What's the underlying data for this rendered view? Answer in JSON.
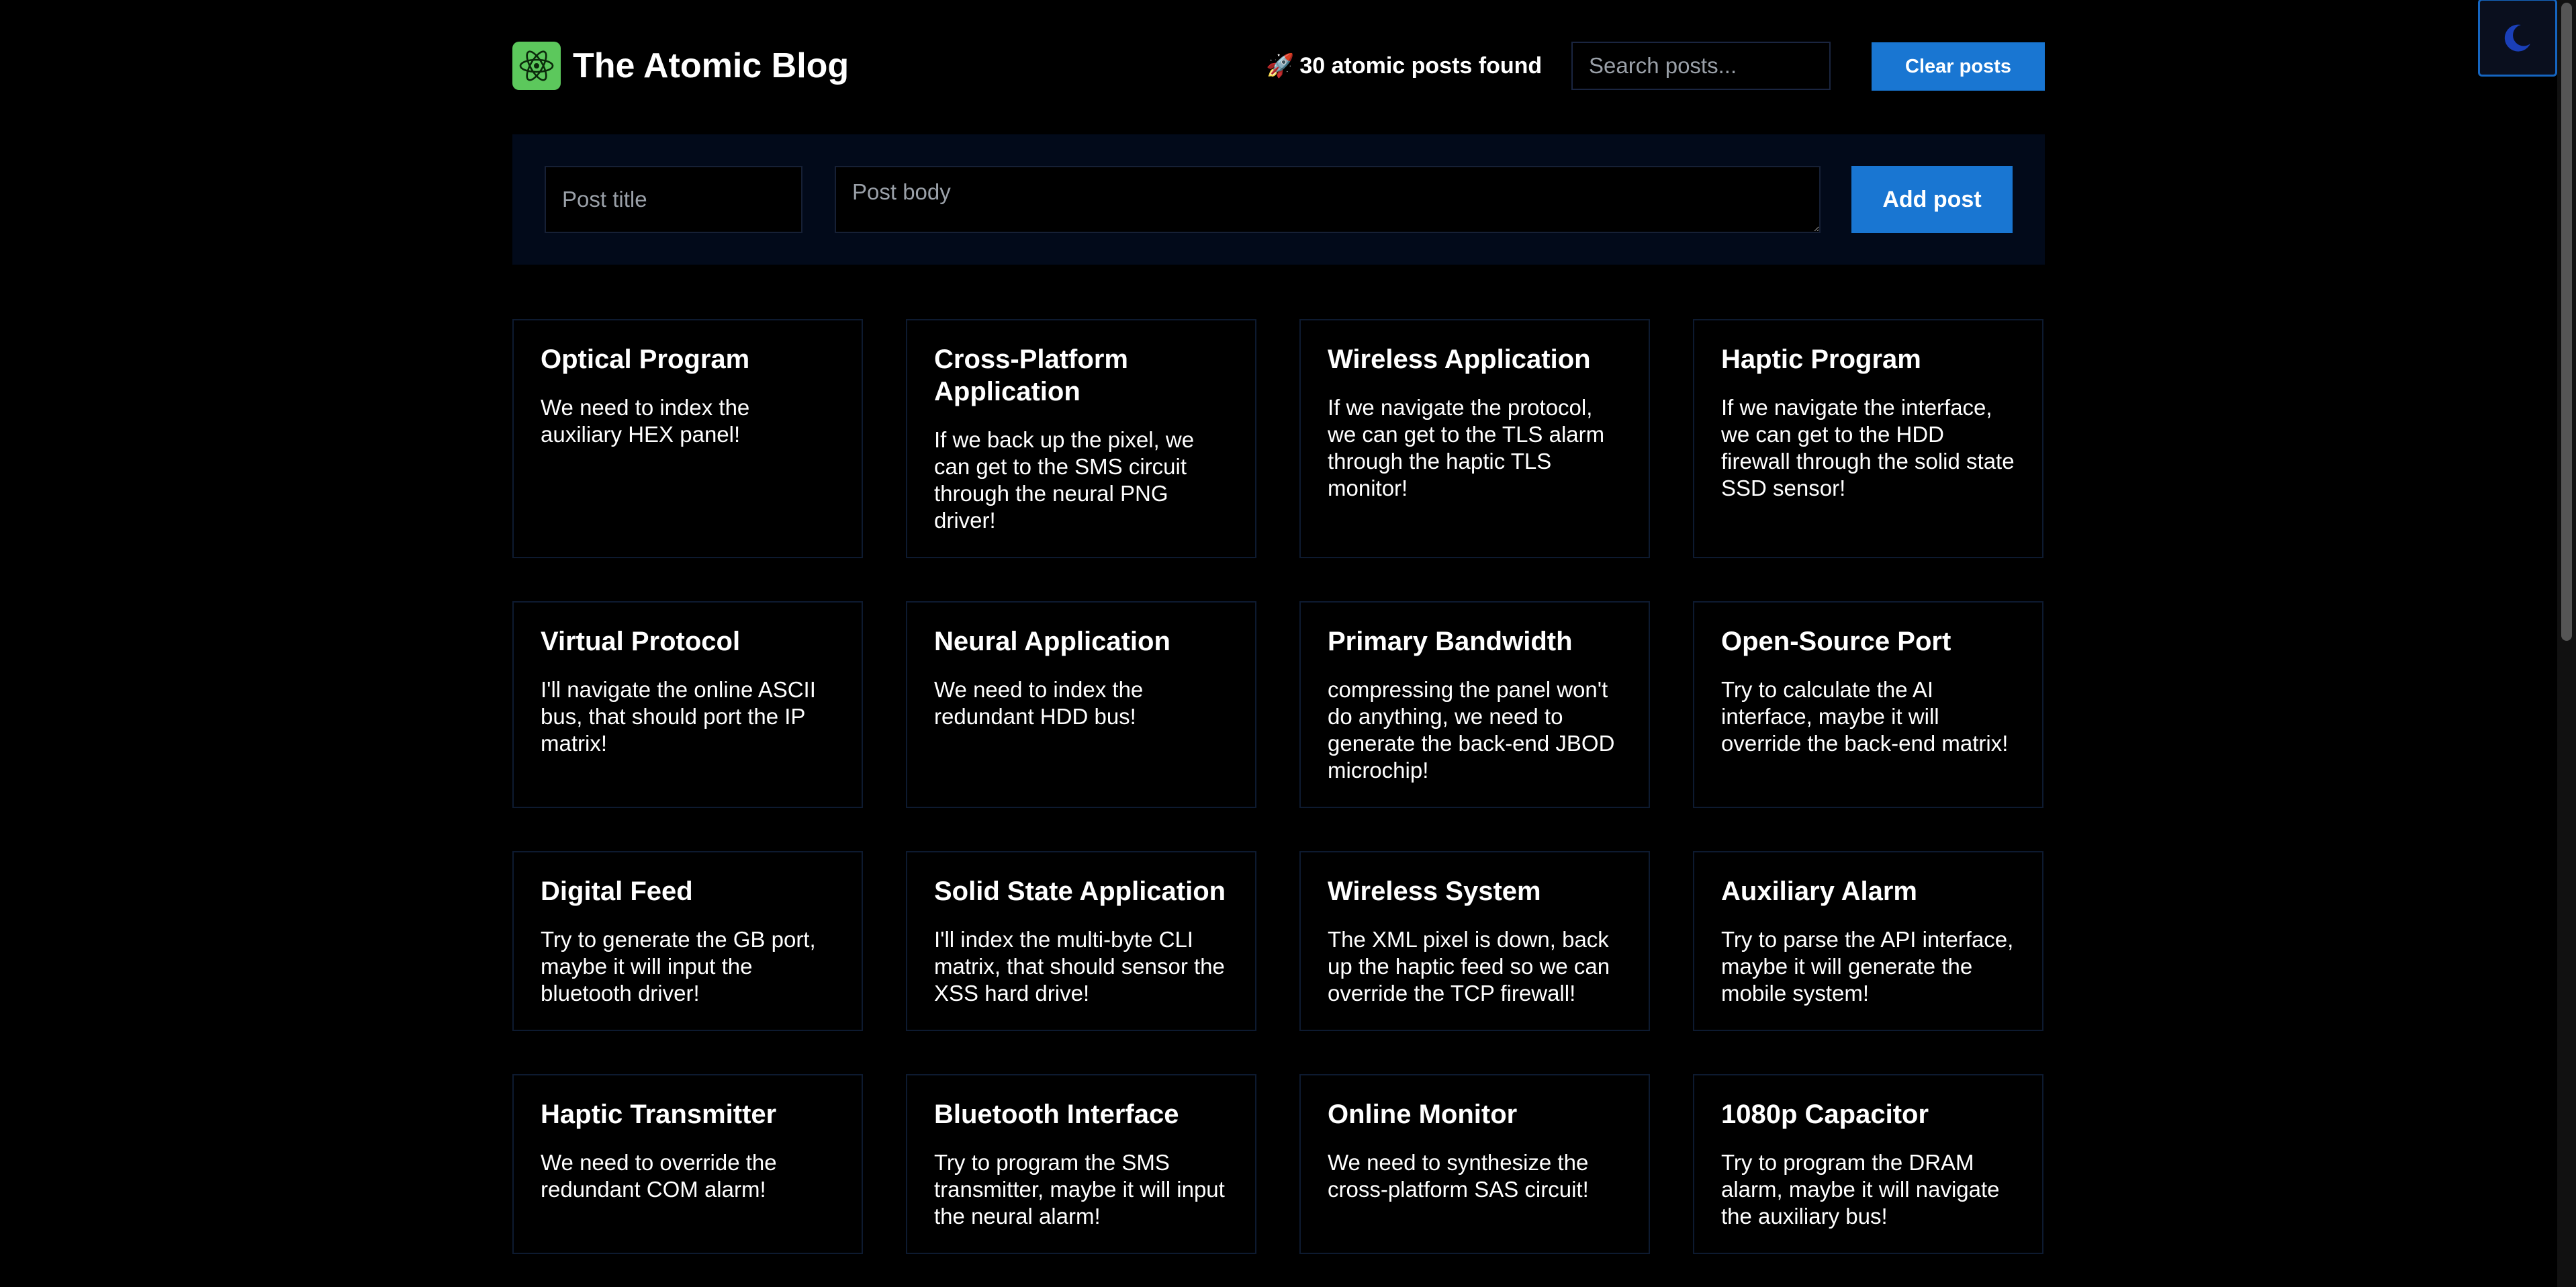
{
  "header": {
    "title": "The Atomic Blog",
    "post_count_text": "30 atomic posts found",
    "rocket": "🚀",
    "search_placeholder": "Search posts...",
    "clear_label": "Clear posts"
  },
  "form": {
    "title_placeholder": "Post title",
    "body_placeholder": "Post body",
    "add_label": "Add post"
  },
  "posts": [
    {
      "title": "Optical Program",
      "body": "We need to index the auxiliary HEX panel!"
    },
    {
      "title": "Cross-Platform Application",
      "body": "If we back up the pixel, we can get to the SMS circuit through the neural PNG driver!"
    },
    {
      "title": "Wireless Application",
      "body": "If we navigate the protocol, we can get to the TLS alarm through the haptic TLS monitor!"
    },
    {
      "title": "Haptic Program",
      "body": "If we navigate the interface, we can get to the HDD firewall through the solid state SSD sensor!"
    },
    {
      "title": "Virtual Protocol",
      "body": "I'll navigate the online ASCII bus, that should port the IP matrix!"
    },
    {
      "title": "Neural Application",
      "body": "We need to index the redundant HDD bus!"
    },
    {
      "title": "Primary Bandwidth",
      "body": "compressing the panel won't do anything, we need to generate the back-end JBOD microchip!"
    },
    {
      "title": "Open-Source Port",
      "body": "Try to calculate the AI interface, maybe it will override the back-end matrix!"
    },
    {
      "title": "Digital Feed",
      "body": "Try to generate the GB port, maybe it will input the bluetooth driver!"
    },
    {
      "title": "Solid State Application",
      "body": "I'll index the multi-byte CLI matrix, that should sensor the XSS hard drive!"
    },
    {
      "title": "Wireless System",
      "body": "The XML pixel is down, back up the haptic feed so we can override the TCP firewall!"
    },
    {
      "title": "Auxiliary Alarm",
      "body": "Try to parse the API interface, maybe it will generate the mobile system!"
    },
    {
      "title": "Haptic Transmitter",
      "body": "We need to override the redundant COM alarm!"
    },
    {
      "title": "Bluetooth Interface",
      "body": "Try to program the SMS transmitter, maybe it will input the neural alarm!"
    },
    {
      "title": "Online Monitor",
      "body": "We need to synthesize the cross-platform SAS circuit!"
    },
    {
      "title": "1080p Capacitor",
      "body": "Try to program the DRAM alarm, maybe it will navigate the auxiliary bus!"
    }
  ],
  "theme_toggle": {
    "icon": "moon-icon"
  },
  "colors": {
    "background": "#000000",
    "accent": "#1976d2",
    "logo": "#5cc85c",
    "panel": "#020a1a",
    "card_border": "#0d1a30"
  }
}
